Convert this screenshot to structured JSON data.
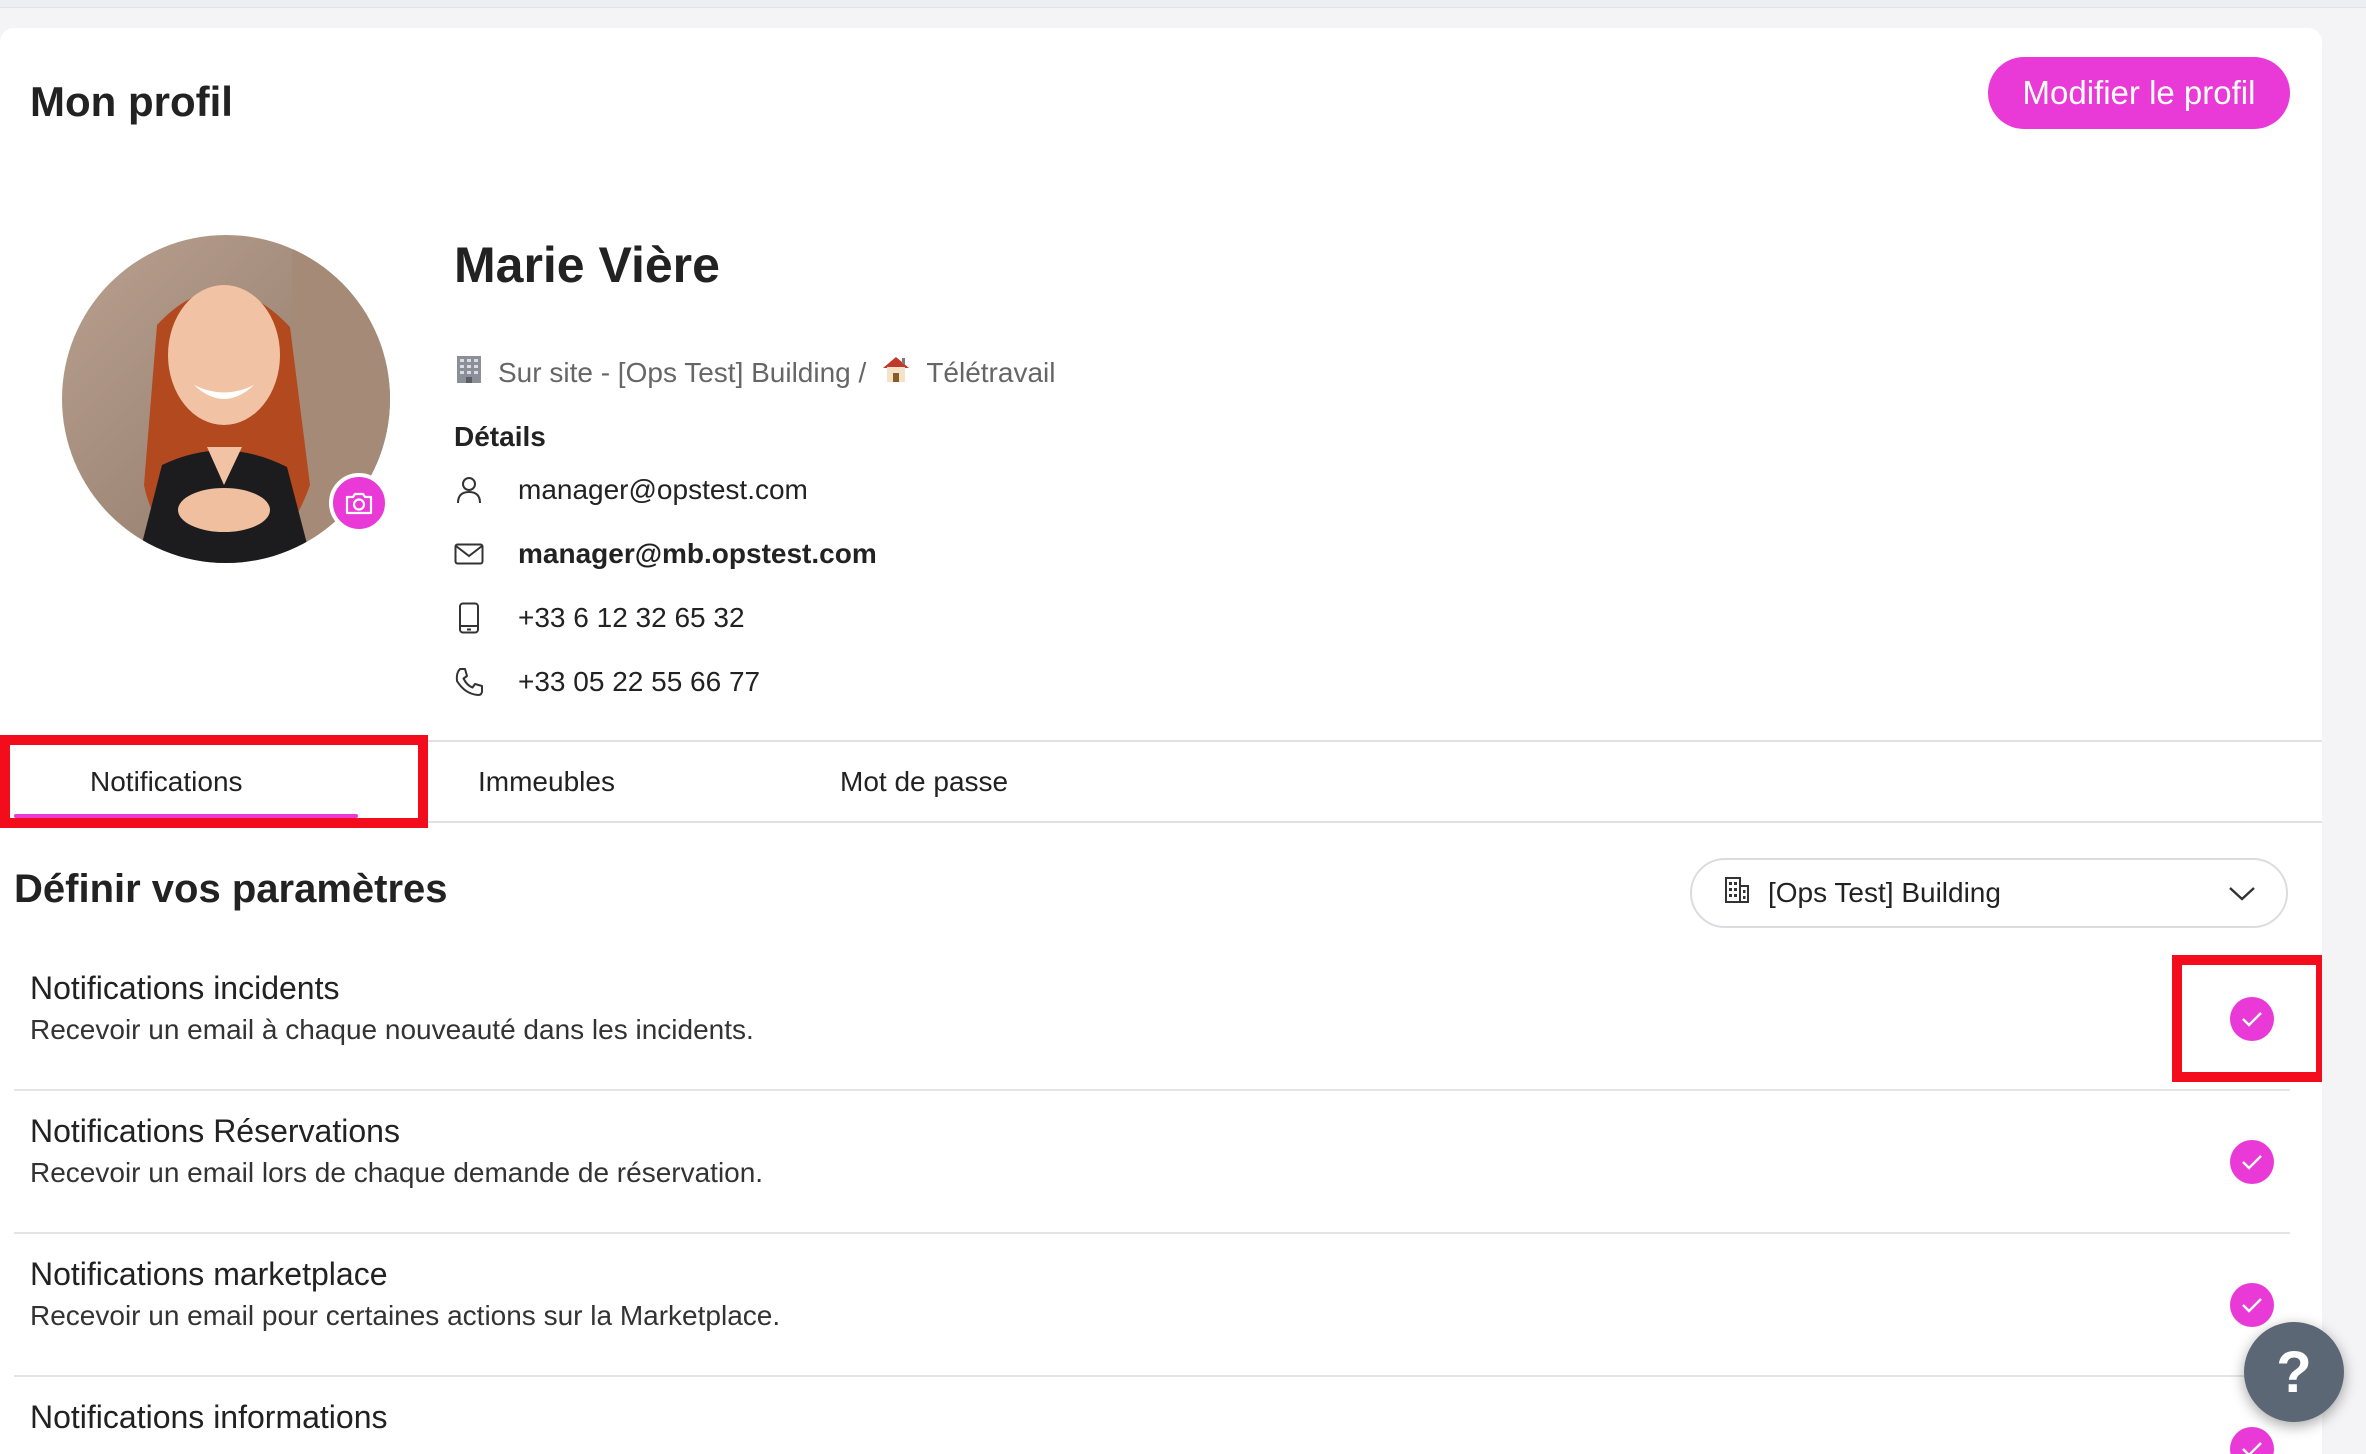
{
  "header": {
    "page_title": "Mon profil",
    "edit_label": "Modifier le profil"
  },
  "profile": {
    "name": "Marie Vière",
    "site_onsite": "Sur site - [Ops Test] Building /",
    "site_remote": "Télétravail",
    "details_title": "Détails",
    "username": "manager@opstest.com",
    "email": "manager@mb.opstest.com",
    "mobile": "+33 6 12 32 65 32",
    "phone": "+33 05 22 55 66 77"
  },
  "tabs": [
    {
      "label": "Notifications",
      "active": true
    },
    {
      "label": "Immeubles",
      "active": false
    },
    {
      "label": "Mot de passe",
      "active": false
    }
  ],
  "settings": {
    "title": "Définir vos paramètres",
    "building_value": "[Ops Test] Building",
    "notifications": [
      {
        "title": "Notifications incidents",
        "description": "Recevoir un email à chaque nouveauté dans les incidents.",
        "enabled": true
      },
      {
        "title": "Notifications Réservations",
        "description": "Recevoir un email lors de chaque demande de réservation.",
        "enabled": true
      },
      {
        "title": "Notifications marketplace",
        "description": "Recevoir un email pour certaines actions sur la Marketplace.",
        "enabled": true
      },
      {
        "title": "Notifications informations",
        "description": "",
        "enabled": true
      }
    ]
  },
  "help": {
    "label": "?"
  },
  "colors": {
    "accent": "#e93ad7",
    "highlight": "#f20c1c"
  }
}
